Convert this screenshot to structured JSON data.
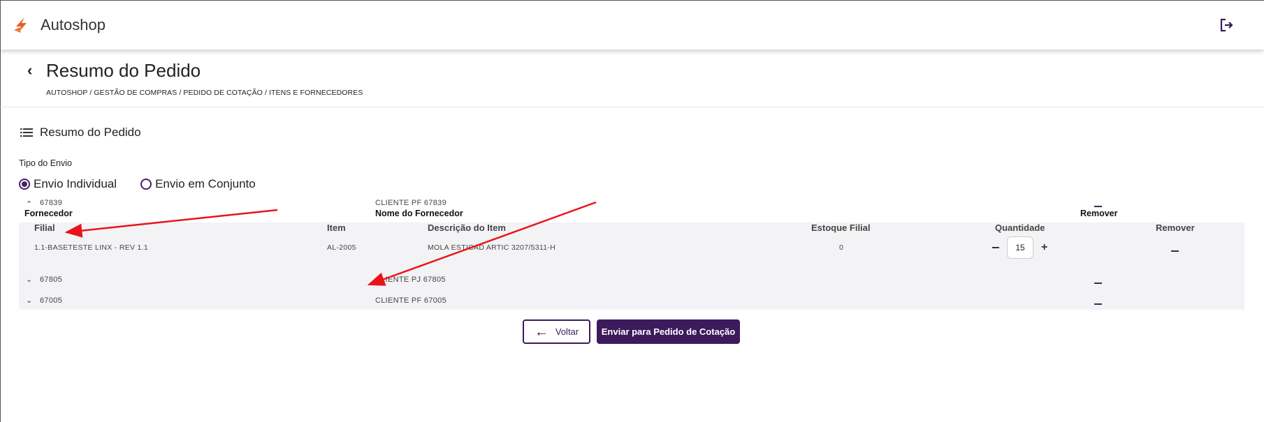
{
  "header": {
    "app_title": "Autoshop",
    "brand_color": "#e5601f"
  },
  "page": {
    "title": "Resumo do Pedido",
    "breadcrumb": "AUTOSHOP / GESTÃO DE COMPRAS / PEDIDO DE COTAÇÃO / ITENS E FORNECEDORES"
  },
  "section": {
    "title": "Resumo do Pedido",
    "tipo_label": "Tipo do Envio",
    "options": [
      {
        "label": "Envio Individual",
        "selected": true
      },
      {
        "label": "Envio em Conjunto",
        "selected": false
      }
    ]
  },
  "table": {
    "headers": {
      "fornecedor": "Fornecedor",
      "nome": "Nome do Fornecedor",
      "remover": "Remover"
    },
    "rows": [
      {
        "code": "67839",
        "name": "CLIENTE PF 67839",
        "expanded": true
      },
      {
        "code": "67805",
        "name": "CLIENTE PJ 67805",
        "expanded": false
      },
      {
        "code": "67005",
        "name": "CLIENTE PF 67005",
        "expanded": false
      }
    ],
    "detail": {
      "headers": {
        "filial": "Filial",
        "item": "Item",
        "descricao": "Descrição do Item",
        "estoque": "Estoque Filial",
        "quantidade": "Quantidade",
        "remover": "Remover"
      },
      "row": {
        "filial": "1.1-BASETESTE LINX - REV 1.1",
        "item": "AL-2005",
        "descricao": "MOLA ESTICAD ARTIC 3207/5311-H",
        "estoque": "0",
        "quantidade": "15"
      }
    }
  },
  "actions": {
    "voltar": "Voltar",
    "enviar": "Enviar para Pedido de Cotação"
  },
  "colors": {
    "primary": "#3d1a5b",
    "annotation": "#e8141a"
  }
}
